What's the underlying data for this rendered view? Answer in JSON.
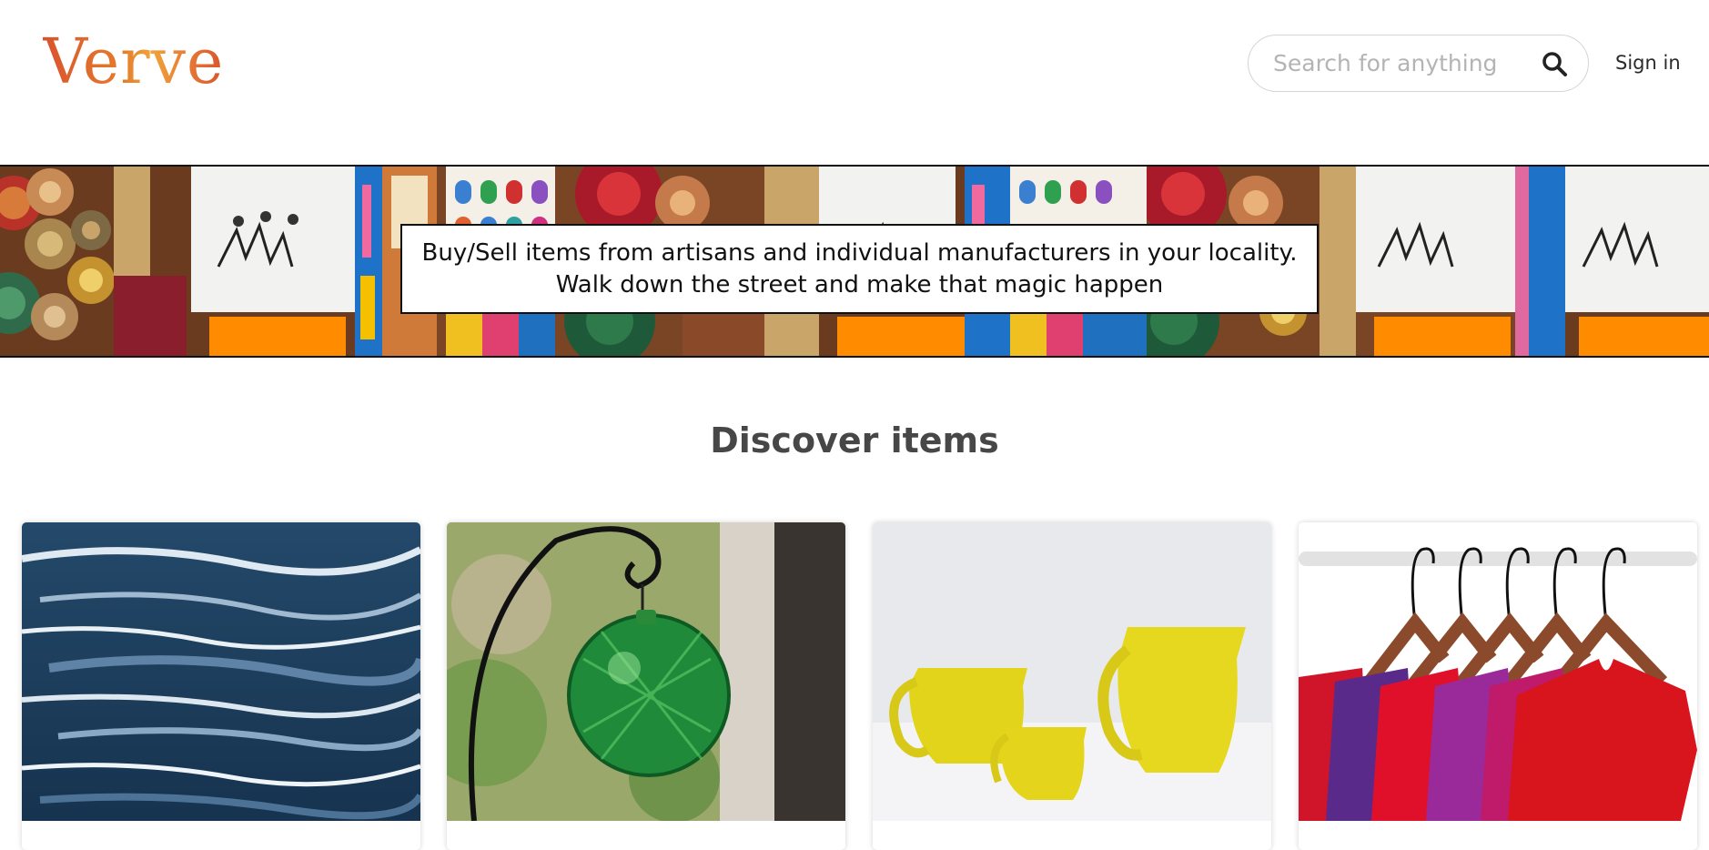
{
  "header": {
    "logo": "Verve",
    "search_placeholder": "Search for anything",
    "search_icon": "search-icon",
    "signin_label": "Sign in"
  },
  "banner": {
    "line1": "Buy/Sell items from artisans and individual manufacturers in your locality.",
    "line2": "Walk down the street and make that magic happen"
  },
  "discover": {
    "title": "Discover items",
    "items": [
      {
        "image": "ocean-painting"
      },
      {
        "image": "green-glass-ornament"
      },
      {
        "image": "yellow-ceramic-pitchers"
      },
      {
        "image": "shirts-on-hangers"
      }
    ]
  },
  "colors": {
    "logo_start": "#d9532e",
    "logo_mid": "#f2a23a",
    "title": "#474747",
    "banner_border": "#111111"
  }
}
